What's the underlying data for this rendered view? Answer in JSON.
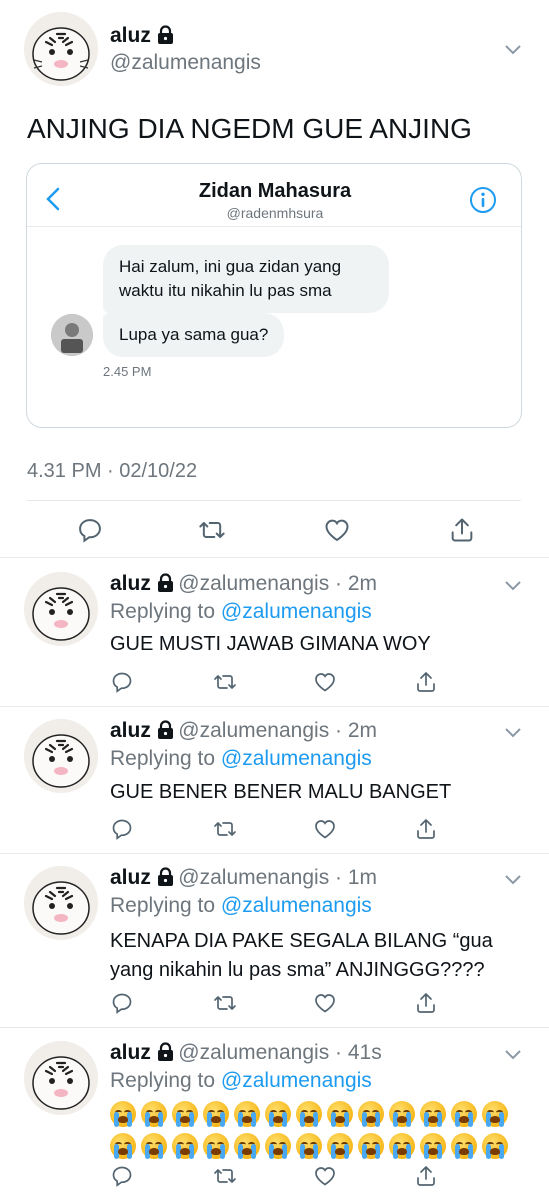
{
  "main_tweet": {
    "name": "aluz",
    "handle": "@zalumenangis",
    "text": "ANJING DIA NGEDM GUE ANJING",
    "timestamp": "4.31 PM · 02/10/22"
  },
  "dm_card": {
    "contact_name": "Zidan Mahasura",
    "contact_handle": "@radenmhsura",
    "messages": [
      "Hai zalum, ini gua zidan yang waktu itu nikahin lu pas sma",
      "Lupa ya sama gua?"
    ],
    "time": "2.45 PM"
  },
  "replies": [
    {
      "name": "aluz",
      "handle": "@zalumenangis",
      "age": "2m",
      "replying_label": "Replying to",
      "replying_to": "@zalumenangis",
      "text": "GUE MUSTI JAWAB GIMANA WOY"
    },
    {
      "name": "aluz",
      "handle": "@zalumenangis",
      "age": "2m",
      "replying_label": "Replying to",
      "replying_to": "@zalumenangis",
      "text": "GUE BENER BENER MALU BANGET"
    },
    {
      "name": "aluz",
      "handle": "@zalumenangis",
      "age": "1m",
      "replying_label": "Replying to",
      "replying_to": "@zalumenangis",
      "text": "KENAPA DIA PAKE SEGALA BILANG “gua yang nikahin lu pas sma” ANJINGGG????"
    },
    {
      "name": "aluz",
      "handle": "@zalumenangis",
      "age": "41s",
      "replying_label": "Replying to",
      "replying_to": "@zalumenangis",
      "emoji_count": 26,
      "emoji_name": "loudly-crying-face"
    }
  ],
  "icons": [
    "chevron-down-icon",
    "lock-icon",
    "back-icon",
    "info-icon",
    "reply-icon",
    "retweet-icon",
    "like-icon",
    "share-icon"
  ],
  "colors": {
    "accent": "#1d9bf0",
    "muted": "#6e767d",
    "divider": "#e7e9ea"
  }
}
